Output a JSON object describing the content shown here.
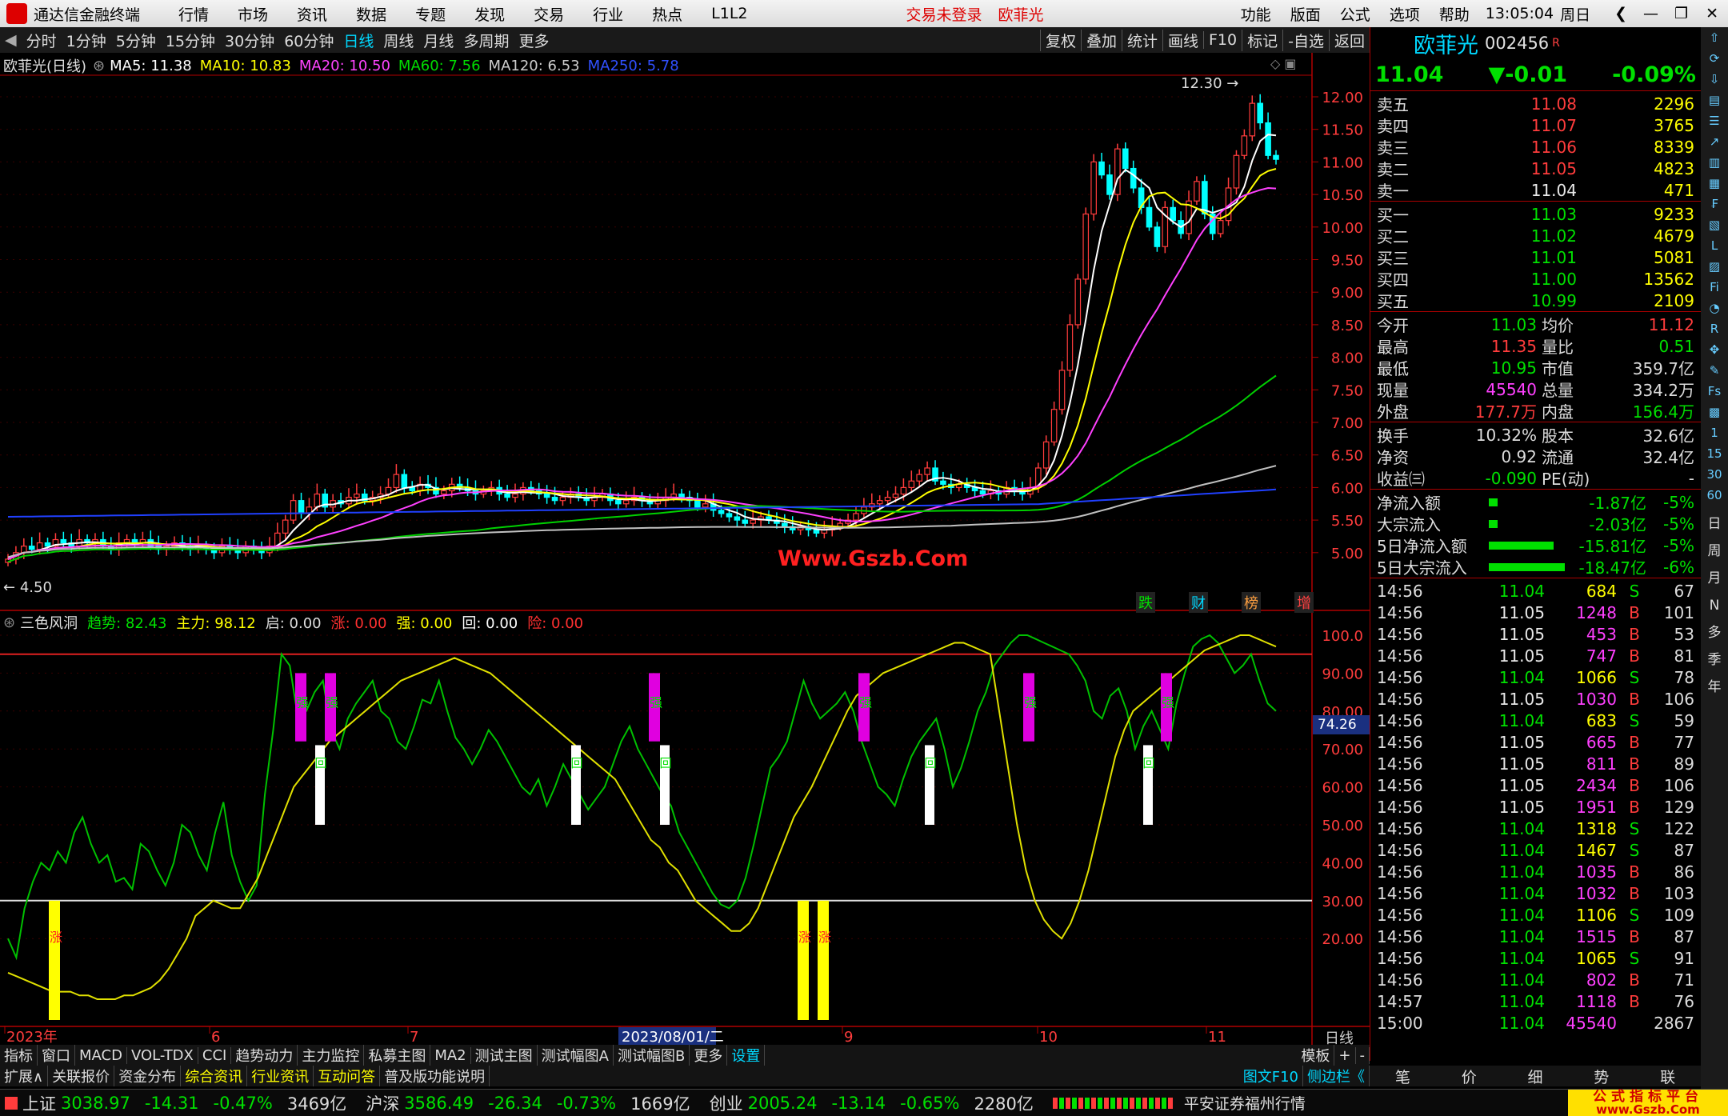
{
  "app": {
    "title": "通达信金融终端",
    "menu": [
      "行情",
      "市场",
      "资讯",
      "数据",
      "专题",
      "发现",
      "交易",
      "行业",
      "热点",
      "L1L2"
    ],
    "login_status": "交易未登录",
    "stock_name": "欧菲光",
    "right_menu": [
      "功能",
      "版面",
      "公式",
      "选项",
      "帮助"
    ],
    "time": "13:05:04",
    "weekday": "周日"
  },
  "period_tabs": [
    "分时",
    "1分钟",
    "5分钟",
    "15分钟",
    "30分钟",
    "60分钟",
    "日线",
    "周线",
    "月线",
    "多周期",
    "更多"
  ],
  "active_period": "日线",
  "tool_buttons": [
    "复权",
    "叠加",
    "统计",
    "画线",
    "F10",
    "标记",
    "-自选",
    "返回"
  ],
  "ma_line": {
    "label": "欧菲光(日线)",
    "ma5": "MA5: 11.38",
    "ma10": "MA10: 10.83",
    "ma20": "MA20: 10.50",
    "ma60": "MA60: 7.56",
    "ma120": "MA120: 6.53",
    "ma250": "MA250: 5.78"
  },
  "price_axis": [
    "12.00",
    "11.50",
    "11.00",
    "10.50",
    "10.00",
    "9.50",
    "9.00",
    "8.50",
    "8.00",
    "7.50",
    "7.00",
    "6.50",
    "6.00",
    "5.50",
    "5.00"
  ],
  "annotations": {
    "high": "12.30",
    "low": "4.50",
    "watermark": "Www.Gszb.Com"
  },
  "badges": [
    "跌",
    "财",
    "榜",
    "增"
  ],
  "indicator": {
    "name": "三色风洞",
    "trend": "趋势: 82.43",
    "main": "主力: 98.12",
    "start": "启: 0.00",
    "rise": "涨: 0.00",
    "strong": "强: 0.00",
    "back": "回: 0.00",
    "risk": "险: 0.00",
    "current": "74.26",
    "strong_label": "强",
    "back_label": "回",
    "rise_label": "涨"
  },
  "ind_axis": [
    "100.0",
    "90.00",
    "80.00",
    "70.00",
    "60.00",
    "50.00",
    "40.00",
    "30.00",
    "20.00"
  ],
  "date_axis": [
    "2023年",
    "6",
    "7",
    "2023/08/01/二",
    "9",
    "10",
    "11"
  ],
  "date_mode": "日线",
  "tabs1": [
    "指标",
    "窗口",
    "MACD",
    "VOL-TDX",
    "CCI",
    "趋势动力",
    "主力监控",
    "私募主图",
    "MA2",
    "测试主图",
    "测试幅图A",
    "测试幅图B",
    "更多",
    "设置"
  ],
  "tabs1_right": [
    "模板",
    "+",
    "-"
  ],
  "tabs2": [
    "扩展∧",
    "关联报价",
    "资金分布",
    "综合资讯",
    "行业资讯",
    "互动问答",
    "普及版功能说明"
  ],
  "tabs2_right": [
    "图文F10",
    "侧边栏《"
  ],
  "quote": {
    "name": "欧菲光",
    "code": "002456",
    "r": "R",
    "price": "11.04",
    "change": "▼-0.01",
    "pct": "-0.09%"
  },
  "asks": [
    {
      "l": "卖五",
      "p": "11.08",
      "v": "2296"
    },
    {
      "l": "卖四",
      "p": "11.07",
      "v": "3765"
    },
    {
      "l": "卖三",
      "p": "11.06",
      "v": "8339"
    },
    {
      "l": "卖二",
      "p": "11.05",
      "v": "4823"
    },
    {
      "l": "卖一",
      "p": "11.04",
      "v": "471"
    }
  ],
  "bids": [
    {
      "l": "买一",
      "p": "11.03",
      "v": "9233"
    },
    {
      "l": "买二",
      "p": "11.02",
      "v": "4679"
    },
    {
      "l": "买三",
      "p": "11.01",
      "v": "5081"
    },
    {
      "l": "买四",
      "p": "11.00",
      "v": "13562"
    },
    {
      "l": "买五",
      "p": "10.99",
      "v": "2109"
    }
  ],
  "stats": [
    {
      "a": "今开",
      "b": "11.03",
      "c": "均价",
      "d": "11.12"
    },
    {
      "a": "最高",
      "b": "11.35",
      "c": "量比",
      "d": "0.51"
    },
    {
      "a": "最低",
      "b": "10.95",
      "c": "市值",
      "d": "359.7亿"
    },
    {
      "a": "现量",
      "b": "45540",
      "c": "总量",
      "d": "334.2万"
    },
    {
      "a": "外盘",
      "b": "177.7万",
      "c": "内盘",
      "d": "156.4万"
    }
  ],
  "stats2": [
    {
      "a": "换手",
      "b": "10.32%",
      "c": "股本",
      "d": "32.6亿"
    },
    {
      "a": "净资",
      "b": "0.92",
      "c": "流通",
      "d": "32.4亿"
    },
    {
      "a": "收益㈢",
      "b": "-0.090",
      "c": "PE(动)",
      "d": "-"
    }
  ],
  "flows": [
    {
      "a": "净流入额",
      "b": "-1.87亿",
      "c": "-5%",
      "w": 12
    },
    {
      "a": "大宗流入",
      "b": "-2.03亿",
      "c": "-5%",
      "w": 12
    },
    {
      "a": "5日净流入额",
      "b": "-15.81亿",
      "c": "-5%",
      "w": 90
    },
    {
      "a": "5日大宗流入",
      "b": "-18.47亿",
      "c": "-6%",
      "w": 105
    }
  ],
  "ticks": [
    [
      "14:56",
      "11.04",
      "684",
      "S",
      "67"
    ],
    [
      "14:56",
      "11.05",
      "1248",
      "B",
      "101"
    ],
    [
      "14:56",
      "11.05",
      "453",
      "B",
      "53"
    ],
    [
      "14:56",
      "11.05",
      "747",
      "B",
      "81"
    ],
    [
      "14:56",
      "11.04",
      "1066",
      "S",
      "78"
    ],
    [
      "14:56",
      "11.05",
      "1030",
      "B",
      "106"
    ],
    [
      "14:56",
      "11.04",
      "683",
      "S",
      "59"
    ],
    [
      "14:56",
      "11.05",
      "665",
      "B",
      "77"
    ],
    [
      "14:56",
      "11.05",
      "811",
      "B",
      "89"
    ],
    [
      "14:56",
      "11.05",
      "2434",
      "B",
      "106"
    ],
    [
      "14:56",
      "11.05",
      "1951",
      "B",
      "129"
    ],
    [
      "14:56",
      "11.04",
      "1318",
      "S",
      "122"
    ],
    [
      "14:56",
      "11.04",
      "1467",
      "S",
      "87"
    ],
    [
      "14:56",
      "11.04",
      "1035",
      "B",
      "86"
    ],
    [
      "14:56",
      "11.04",
      "1032",
      "B",
      "103"
    ],
    [
      "14:56",
      "11.04",
      "1106",
      "S",
      "109"
    ],
    [
      "14:56",
      "11.04",
      "1515",
      "B",
      "87"
    ],
    [
      "14:56",
      "11.04",
      "1065",
      "S",
      "91"
    ],
    [
      "14:56",
      "11.04",
      "802",
      "B",
      "71"
    ],
    [
      "14:57",
      "11.04",
      "1118",
      "B",
      "76"
    ],
    [
      "15:00",
      "11.04",
      "45540",
      "",
      "2867"
    ]
  ],
  "rp_bottom_tabs": [
    "笔",
    "价",
    "细",
    "势",
    "联"
  ],
  "right_icons": [
    "日",
    "周",
    "月",
    "N",
    "多",
    "季",
    "年"
  ],
  "market": {
    "sh_label": "上证",
    "sh": "3038.97",
    "sh_chg": "-14.31",
    "sh_pct": "-0.47%",
    "sh_amt": "3469亿",
    "sz_label": "沪深",
    "sz": "3586.49",
    "sz_chg": "-26.34",
    "sz_pct": "-0.73%",
    "sz_amt": "1669亿",
    "cy_label": "创业",
    "cy": "2005.24",
    "cy_chg": "-13.14",
    "cy_pct": "-0.65%",
    "cy_amt": "2280亿",
    "broker": "平安证券福州行情",
    "logo": "公式指标平台",
    "logo_url": "www.Gszb.Com"
  },
  "colors": {
    "up": "#ff3c3c",
    "down": "#00ffff",
    "ma5": "#ffffff",
    "ma10": "#ffff00",
    "ma20": "#ff40ff",
    "ma60": "#00d000",
    "ma120": "#c0c0c0",
    "ma250": "#2040ff"
  }
}
